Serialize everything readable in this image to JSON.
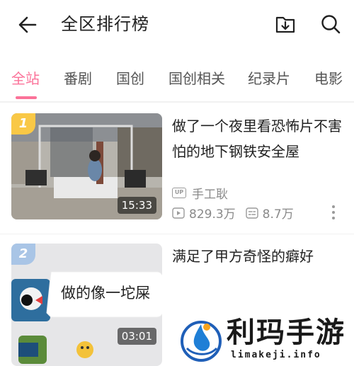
{
  "header": {
    "title": "全区排行榜",
    "back_icon": "back-arrow-icon",
    "download_icon": "download-icon",
    "search_icon": "search-icon"
  },
  "tabs": [
    {
      "label": "全站",
      "active": true
    },
    {
      "label": "番剧",
      "active": false
    },
    {
      "label": "国创",
      "active": false
    },
    {
      "label": "国创相关",
      "active": false
    },
    {
      "label": "纪录片",
      "active": false
    },
    {
      "label": "电影",
      "active": false
    }
  ],
  "videos": [
    {
      "rank": "1",
      "title": "做了一个夜里看恐怖片不害怕的地下钢铁安全屋",
      "duration": "15:33",
      "up_tag": "UP",
      "uploader": "手工耿",
      "views": "829.3万",
      "danmaku": "8.7万"
    },
    {
      "rank": "2",
      "title": "满足了甲方奇怪的癖好",
      "duration": "03:01",
      "thumb_text": "做的像一坨屎"
    }
  ],
  "watermark": {
    "name": "利玛手游",
    "url": "limakeji.info"
  },
  "colors": {
    "accent": "#fb7299",
    "rank1": "#f9c846",
    "rank2": "#a9c5e6"
  }
}
